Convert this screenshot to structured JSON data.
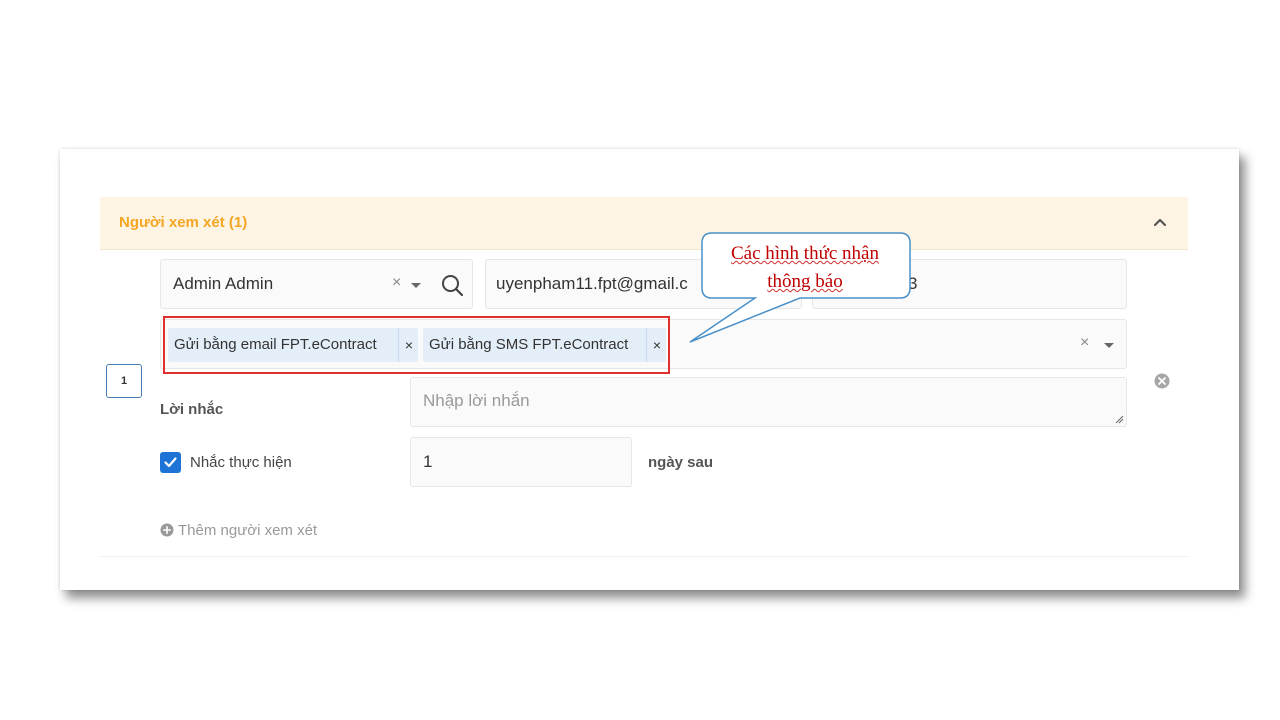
{
  "section": {
    "title": "Người xem xét (1)"
  },
  "reviewer": {
    "row_number": "1",
    "name_value": "Admin Admin",
    "email_value": "uyenpham11.fpt@gmail.c",
    "phone_value_partial": "3"
  },
  "notification_methods": {
    "tags": [
      {
        "label": "Gửi bằng email FPT.eContract"
      },
      {
        "label": "Gửi bằng SMS FPT.eContract"
      }
    ]
  },
  "reminder": {
    "message_label": "Lời nhắc",
    "message_placeholder": "Nhập lời nhắn",
    "enable_label": "Nhắc thực hiện",
    "checked": true,
    "days_value": "1",
    "days_suffix": "ngày sau"
  },
  "actions": {
    "add_reviewer_label": "Thêm người xem xét"
  },
  "callout": {
    "line1": "Các hình thức nhận",
    "line2": "thông báo"
  },
  "colors": {
    "accent_orange": "#f5a623",
    "header_bg": "#fdf4e3",
    "checkbox_blue": "#1e73d7",
    "highlight_red": "#e0302e",
    "tag_bg": "#e3eef8",
    "callout_text": "#c00000",
    "callout_border": "#4a90c8"
  },
  "icons": {
    "collapse": "chevron-up-icon",
    "search": "search-icon",
    "clear": "close-icon",
    "dropdown": "caret-down-icon",
    "remove_row": "close-circle-icon",
    "add": "plus-circle-icon",
    "check": "check-icon"
  }
}
